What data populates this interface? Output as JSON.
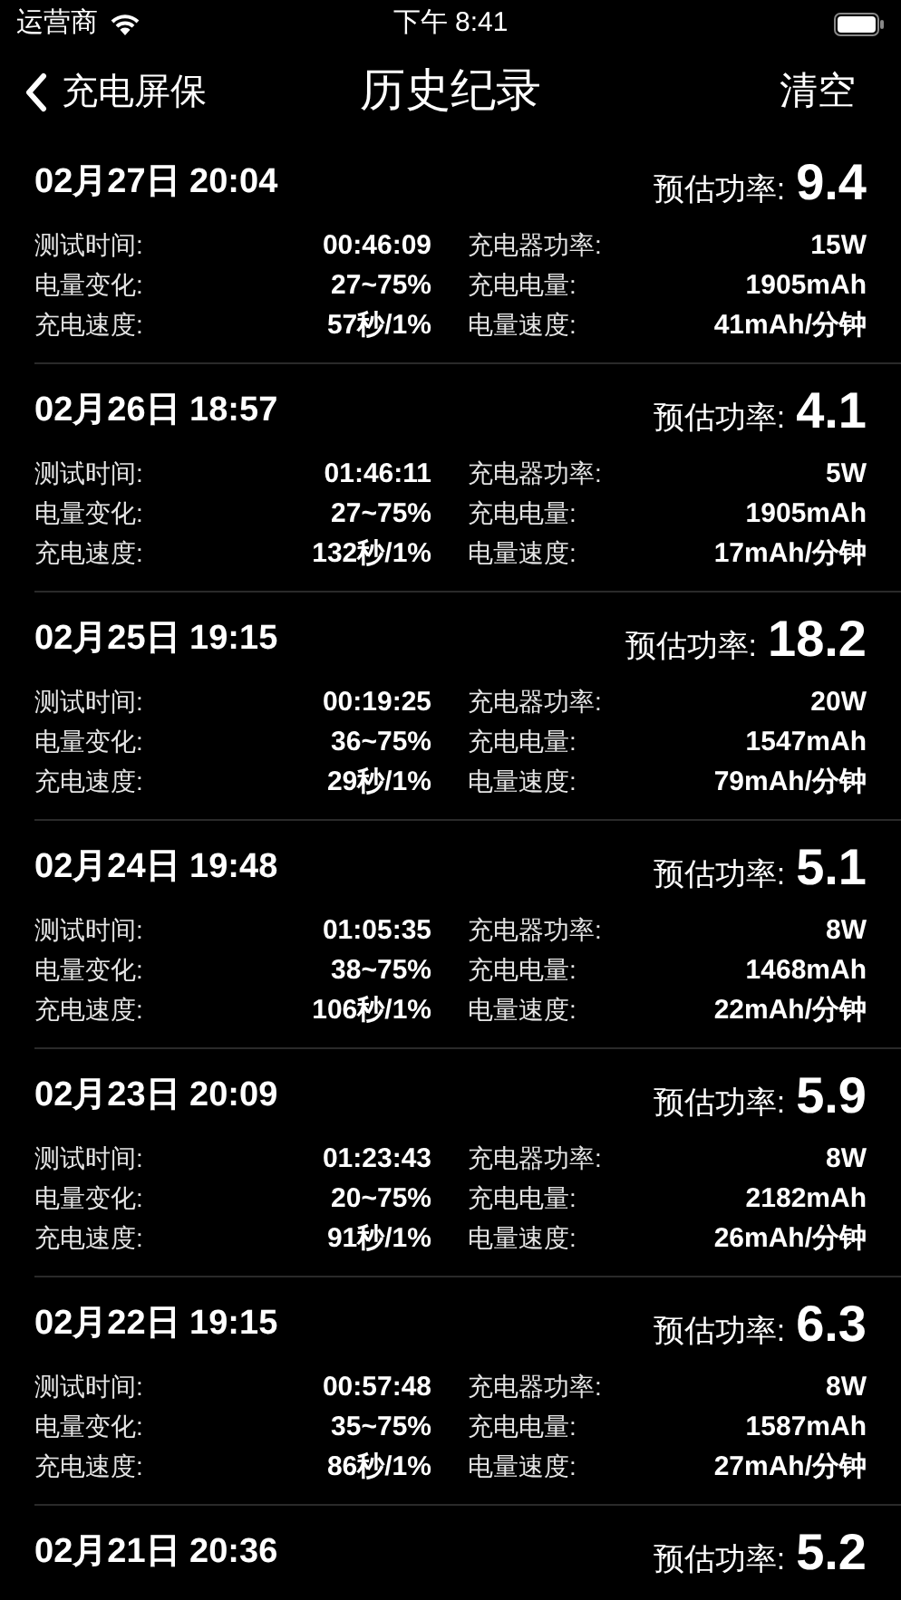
{
  "status_bar": {
    "carrier": "运营商",
    "time": "下午 8:41"
  },
  "nav": {
    "back": "充电屏保",
    "title": "历史纪录",
    "action": "清空"
  },
  "records": [
    {
      "date": "02月27日 20:04",
      "power_label": "预估功率:",
      "power": "9.4",
      "rows": [
        [
          "测试时间:",
          "00:46:09",
          "充电器功率:",
          "15W"
        ],
        [
          "电量变化:",
          "27~75%",
          "充电电量:",
          "1905mAh"
        ],
        [
          "充电速度:",
          "57秒/1%",
          "电量速度:",
          "41mAh/分钟"
        ]
      ]
    },
    {
      "date": "02月26日 18:57",
      "power_label": "预估功率:",
      "power": "4.1",
      "rows": [
        [
          "测试时间:",
          "01:46:11",
          "充电器功率:",
          "5W"
        ],
        [
          "电量变化:",
          "27~75%",
          "充电电量:",
          "1905mAh"
        ],
        [
          "充电速度:",
          "132秒/1%",
          "电量速度:",
          "17mAh/分钟"
        ]
      ]
    },
    {
      "date": "02月25日 19:15",
      "power_label": "预估功率:",
      "power": "18.2",
      "rows": [
        [
          "测试时间:",
          "00:19:25",
          "充电器功率:",
          "20W"
        ],
        [
          "电量变化:",
          "36~75%",
          "充电电量:",
          "1547mAh"
        ],
        [
          "充电速度:",
          "29秒/1%",
          "电量速度:",
          "79mAh/分钟"
        ]
      ]
    },
    {
      "date": "02月24日 19:48",
      "power_label": "预估功率:",
      "power": "5.1",
      "rows": [
        [
          "测试时间:",
          "01:05:35",
          "充电器功率:",
          "8W"
        ],
        [
          "电量变化:",
          "38~75%",
          "充电电量:",
          "1468mAh"
        ],
        [
          "充电速度:",
          "106秒/1%",
          "电量速度:",
          "22mAh/分钟"
        ]
      ]
    },
    {
      "date": "02月23日 20:09",
      "power_label": "预估功率:",
      "power": "5.9",
      "rows": [
        [
          "测试时间:",
          "01:23:43",
          "充电器功率:",
          "8W"
        ],
        [
          "电量变化:",
          "20~75%",
          "充电电量:",
          "2182mAh"
        ],
        [
          "充电速度:",
          "91秒/1%",
          "电量速度:",
          "26mAh/分钟"
        ]
      ]
    },
    {
      "date": "02月22日 19:15",
      "power_label": "预估功率:",
      "power": "6.3",
      "rows": [
        [
          "测试时间:",
          "00:57:48",
          "充电器功率:",
          "8W"
        ],
        [
          "电量变化:",
          "35~75%",
          "充电电量:",
          "1587mAh"
        ],
        [
          "充电速度:",
          "86秒/1%",
          "电量速度:",
          "27mAh/分钟"
        ]
      ]
    },
    {
      "date": "02月21日 20:36",
      "power_label": "预估功率:",
      "power": "5.2"
    }
  ]
}
